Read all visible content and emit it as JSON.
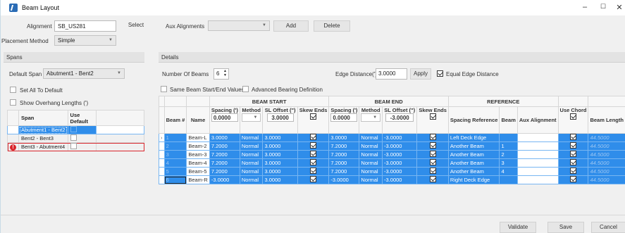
{
  "window": {
    "title": "Beam Layout",
    "min": "–",
    "max": "☐",
    "close": "✕"
  },
  "top": {
    "alignment_label": "Alignment",
    "alignment_value": "SB_US281",
    "select_label": "Select",
    "aux_label": "Aux Alignments",
    "aux_value": "",
    "add_label": "Add",
    "delete_label": "Delete",
    "placement_label": "Placement Method",
    "placement_value": "Simple"
  },
  "spans": {
    "header": "Spans",
    "default_span_label": "Default Span",
    "default_span_value": "Abutment1 - Bent2",
    "set_all_default": "Set All To Default",
    "show_overhang": "Show Overhang Lengths (')",
    "col_span": "Span",
    "col_use_default": "Use Default",
    "rows": [
      {
        "name": "Abutment1 - Bent2"
      },
      {
        "name": "Bent2 - Bent3"
      },
      {
        "name": "Bent3 - Abutment4"
      }
    ]
  },
  "details": {
    "header": "Details",
    "num_beams_label": "Number Of Beams",
    "num_beams_value": "6",
    "edge_label": "Edge Distance(')",
    "edge_value": "3.0000",
    "apply_label": "Apply",
    "equal_edge_label": "Equal Edge Distance",
    "same_beam_label": "Same Beam Start/End Values",
    "adv_bearing_label": "Advanced Bearing Definition"
  },
  "grid": {
    "groups": {
      "beam_start": "BEAM START",
      "beam_end": "BEAM END",
      "reference": "REFERENCE"
    },
    "cols": {
      "beam_num": "Beam #",
      "name": "Name",
      "spacing": "Spacing (')",
      "method": "Method",
      "sl_offset": "SL Offset (\")",
      "skew": "Skew Ends",
      "spacing2": "Spacing (')",
      "method2": "Method",
      "sl_offset2": "SL Offset (\")",
      "skew2": "Skew Ends",
      "spacing_ref": "Spacing Reference",
      "beam": "Beam",
      "aux": "Aux Alignment",
      "use_chord": "Use Chord",
      "beam_length": "Beam Length"
    },
    "defaults": {
      "spacing": "0.0000",
      "sl_offset": "3.0000",
      "spacing2": "0.0000",
      "sl_offset2": "-3.0000"
    },
    "rows": [
      {
        "num": "1",
        "name": "Beam-L",
        "sp": "3.0000",
        "m": "Normal",
        "sl": "3.0000",
        "sp2": "3.0000",
        "m2": "Normal",
        "sl2": "-3.0000",
        "ref": "Left Deck Edge",
        "beam": "",
        "len": "44.5000"
      },
      {
        "num": "2",
        "name": "Beam-2",
        "sp": "7.2000",
        "m": "Normal",
        "sl": "3.0000",
        "sp2": "7.2000",
        "m2": "Normal",
        "sl2": "-3.0000",
        "ref": "Another Beam",
        "beam": "1",
        "len": "44.5000"
      },
      {
        "num": "3",
        "name": "Beam-3",
        "sp": "7.2000",
        "m": "Normal",
        "sl": "3.0000",
        "sp2": "7.2000",
        "m2": "Normal",
        "sl2": "-3.0000",
        "ref": "Another Beam",
        "beam": "2",
        "len": "44.5000"
      },
      {
        "num": "4",
        "name": "Beam-4",
        "sp": "7.2000",
        "m": "Normal",
        "sl": "3.0000",
        "sp2": "7.2000",
        "m2": "Normal",
        "sl2": "-3.0000",
        "ref": "Another Beam",
        "beam": "3",
        "len": "44.5000"
      },
      {
        "num": "5",
        "name": "Beam-5",
        "sp": "7.2000",
        "m": "Normal",
        "sl": "3.0000",
        "sp2": "7.2000",
        "m2": "Normal",
        "sl2": "-3.0000",
        "ref": "Another Beam",
        "beam": "4",
        "len": "44.5000"
      },
      {
        "num": "6",
        "name": "Beam-R",
        "sp": "-3.0000",
        "m": "Normal",
        "sl": "3.0000",
        "sp2": "-3.0000",
        "m2": "Normal",
        "sl2": "-3.0000",
        "ref": "Right Deck Edge",
        "beam": "",
        "len": "44.5000"
      }
    ]
  },
  "footer": {
    "validate": "Validate",
    "save": "Save",
    "cancel": "Cancel"
  },
  "colors": {
    "selection": "#2f8dea",
    "error": "#d9262c"
  }
}
